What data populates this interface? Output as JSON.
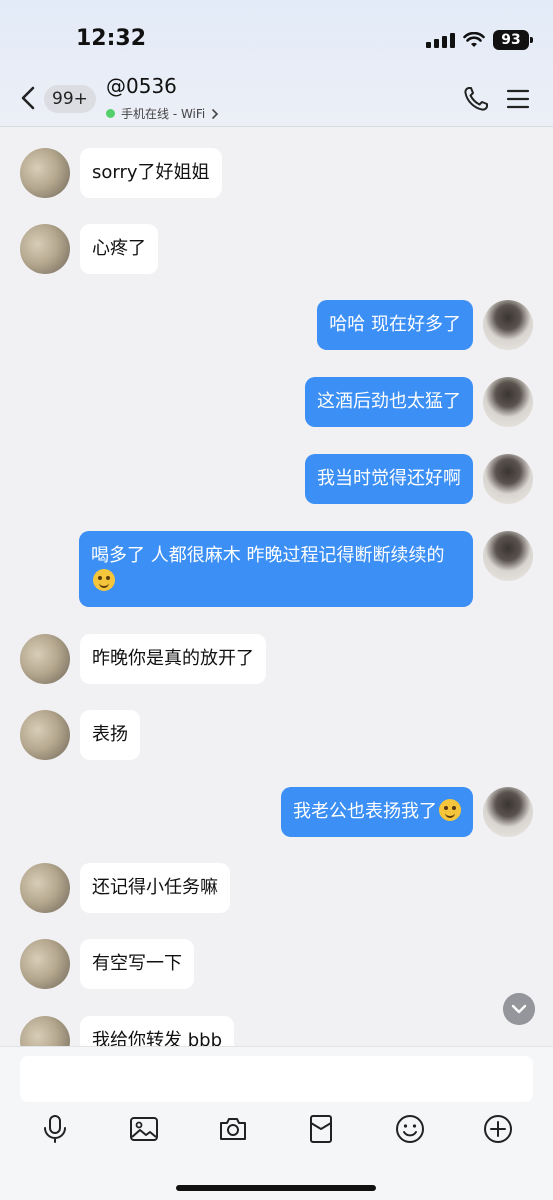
{
  "status_bar": {
    "time": "12:32",
    "battery": "93"
  },
  "header": {
    "unread_badge": "99+",
    "contact_name": "@0536",
    "online_status": "手机在线 - WiFi"
  },
  "messages": [
    {
      "side": "in",
      "text": "sorry了好姐姐"
    },
    {
      "side": "in",
      "text": "心疼了"
    },
    {
      "side": "out",
      "text": "哈哈 现在好多了"
    },
    {
      "side": "out",
      "text": "这酒后劲也太猛了"
    },
    {
      "side": "out",
      "text": "我当时觉得还好啊"
    },
    {
      "side": "out",
      "text": "喝多了 人都很麻木 昨晚过程记得断断续续的"
    },
    {
      "side": "in",
      "text": "昨晚你是真的放开了"
    },
    {
      "side": "in",
      "text": "表扬"
    },
    {
      "side": "out",
      "text": "我老公也表扬我了"
    },
    {
      "side": "in",
      "text": "还记得小任务嘛"
    },
    {
      "side": "in",
      "text": "有空写一下"
    },
    {
      "side": "in",
      "text": "我给你转发 bbb"
    }
  ],
  "composer": {
    "placeholder": ""
  },
  "toolbar_icons": [
    "microphone-icon",
    "image-icon",
    "camera-icon",
    "red-packet-icon",
    "emoji-icon",
    "plus-icon"
  ],
  "colors": {
    "outgoing_bubble": "#3b8ff5",
    "incoming_bubble": "#ffffff",
    "background": "#f1f1f3",
    "online_dot": "#54d06a"
  }
}
